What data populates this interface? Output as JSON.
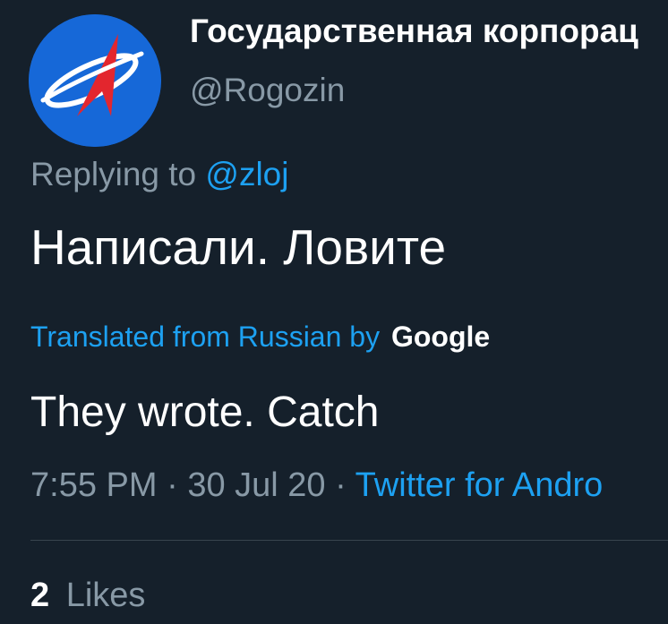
{
  "author": {
    "display_name": "Государственная корпорац",
    "handle": "@Rogozin",
    "avatar_icon": "roscosmos-logo-icon"
  },
  "reply": {
    "prefix": "Replying to",
    "mention": "@zloj"
  },
  "tweet": {
    "text": "Написали. Ловите",
    "translation_label": "Translated from Russian by",
    "translation_provider": "Google",
    "translation": "They wrote. Catch"
  },
  "meta": {
    "time": "7:55 PM",
    "separator": "·",
    "date": "30 Jul 20",
    "source": "Twitter for Andro"
  },
  "stats": {
    "likes_count": "2",
    "likes_label": "Likes"
  },
  "colors": {
    "background": "#15202b",
    "accent": "#1da1f2",
    "muted": "#8899a6",
    "logo_blue": "#1668d8",
    "logo_red": "#e3262e"
  }
}
